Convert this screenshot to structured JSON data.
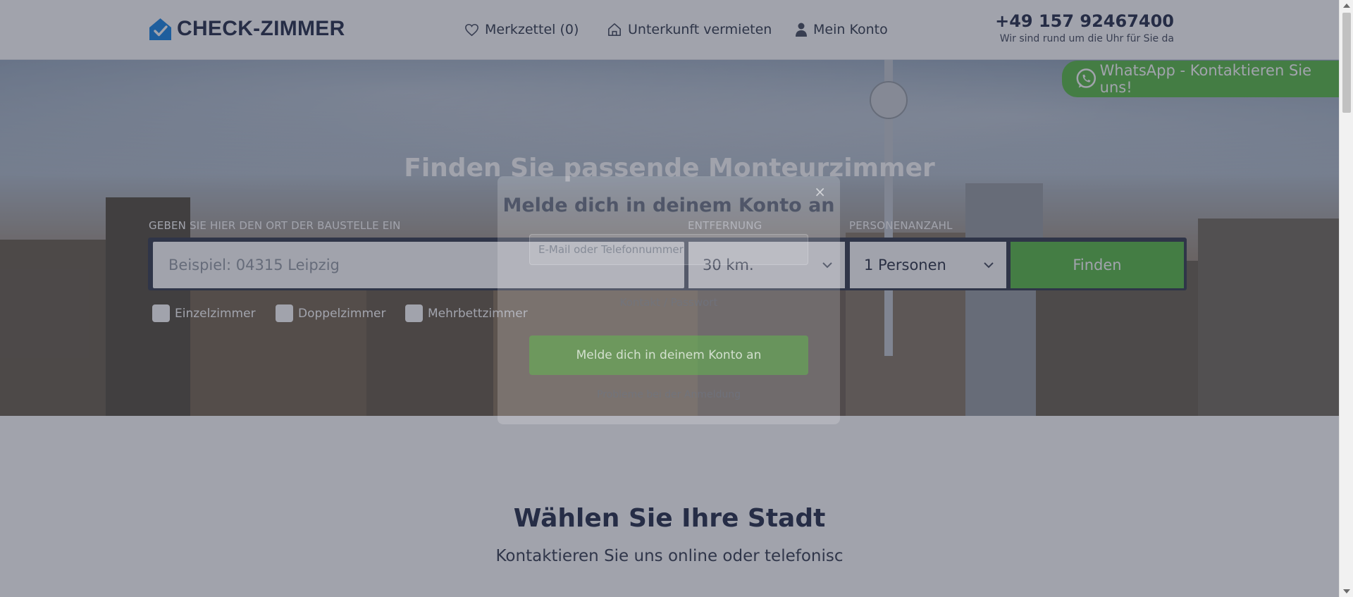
{
  "header": {
    "logo_text": "CHECK-ZIMMER",
    "nav": {
      "favorites": "Merkzettel (0)",
      "rent_out": "Unterkunft vermieten",
      "account": "Mein Konto"
    },
    "phone": "+49 157 92467400",
    "phone_sub": "Wir sind rund um die Uhr für Sie da"
  },
  "whatsapp": {
    "label": "WhatsApp - Kontaktieren Sie uns!"
  },
  "hero": {
    "title": "Finden Sie passende Monteurzimmer",
    "place_label": "GEBEN SIE HIER DEN ORT DER BAUSTELLE EIN",
    "place_placeholder": "Beispiel: 04315 Leipzig",
    "distance_label": "ENTFERNUNG",
    "distance_value": "30 km.",
    "persons_label": "PERSONENANZAHL",
    "persons_value": "1 Personen",
    "find_button": "Finden",
    "room_types": [
      "Einzelzimmer",
      "Doppelzimmer",
      "Mehrbettzimmer"
    ]
  },
  "section": {
    "title": "Wählen Sie Ihre Stadt",
    "subtitle": "Kontaktieren Sie uns online oder telefonisc"
  },
  "modal": {
    "close": "×",
    "title": "Melde dich in deinem Konto an",
    "input_placeholder": "E-Mail oder Telefonnummer",
    "hint": "Kontakt / Passwort",
    "button": "Melde dich in deinem Konto an",
    "link": "Probleme bei der Anmeldung"
  },
  "colors": {
    "brand_dark": "#2b3550",
    "brand_blue": "#1e88e5",
    "accent_green": "#5fbd4c",
    "overlay": "rgba(30,36,58,0.42)"
  },
  "icons": {
    "logo": "house-check-icon",
    "favorites": "heart-icon",
    "rent_out": "home-icon",
    "account": "person-icon",
    "whatsapp": "whatsapp-icon",
    "select": "chevron-down-icon"
  }
}
